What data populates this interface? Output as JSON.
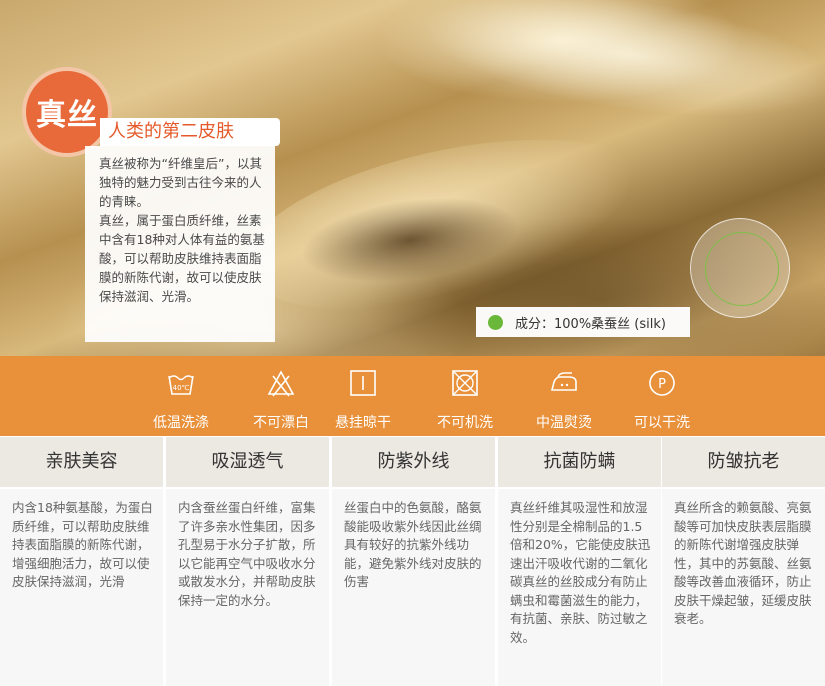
{
  "hero": {
    "badge": "真丝",
    "tagline": "人类的第二皮肤",
    "desc_p1": "真丝被称为“纤维皇后”，以其独特的魅力受到古往今来的人的青睐。",
    "desc_p2": "真丝，属于蛋白质纤维，丝素中含有18种对人体有益的氨基酸，可以帮助皮肤维持表面脂膜的新陈代谢，故可以使皮肤保持滋润、光滑。",
    "composition": "成分：100%桑蚕丝 (silk)"
  },
  "care": [
    {
      "label": "低温洗涤",
      "icon": "low-temp-wash-icon",
      "temp": "40℃"
    },
    {
      "label": "不可漂白",
      "icon": "no-bleach-icon"
    },
    {
      "label": "悬挂晾干",
      "icon": "line-dry-icon"
    },
    {
      "label": "不可机洗",
      "icon": "no-machine-wash-icon"
    },
    {
      "label": "中温熨烫",
      "icon": "medium-iron-icon"
    },
    {
      "label": "可以干洗",
      "icon": "dry-clean-icon",
      "letter": "P"
    }
  ],
  "features": [
    {
      "title": "亲肤美容",
      "text": "内含18种氨基酸，为蛋白质纤维，可以帮助皮肤维持表面脂膜的新陈代谢，增强细胞活力，故可以使皮肤保持滋润，光滑"
    },
    {
      "title": "吸湿透气",
      "text": "内含蚕丝蛋白纤维，富集了许多亲水性集团，因多孔型易于水分子扩散，所以它能再空气中吸收水分或散发水分，并帮助皮肤保持一定的水分。"
    },
    {
      "title": "防紫外线",
      "text": "丝蛋白中的色氨酸，酪氨酸能吸收紫外线因此丝绸具有较好的抗紫外线功能，避免紫外线对皮肤的伤害"
    },
    {
      "title": "抗菌防螨",
      "text": "真丝纤维其吸湿性和放湿性分别是全棉制品的1.5倍和20%，它能使皮肤迅速出汗吸收代谢的二氧化碳真丝的丝胶成分有防止螨虫和霉菌滋生的能力，有抗菌、亲肤、防过敏之效。"
    },
    {
      "title": "防皱抗老",
      "text": "真丝所含的赖氨酸、亮氨酸等可加快皮肤表层脂膜的新陈代谢增强皮肤弹性，其中的苏氨酸、丝氨酸等改善血液循环，防止皮肤干燥起皱，延缓皮肤衰老。"
    }
  ],
  "colors": {
    "accent_orange": "#e8913a",
    "badge_orange": "#e86a3a",
    "green_dot": "#6ab73a"
  }
}
